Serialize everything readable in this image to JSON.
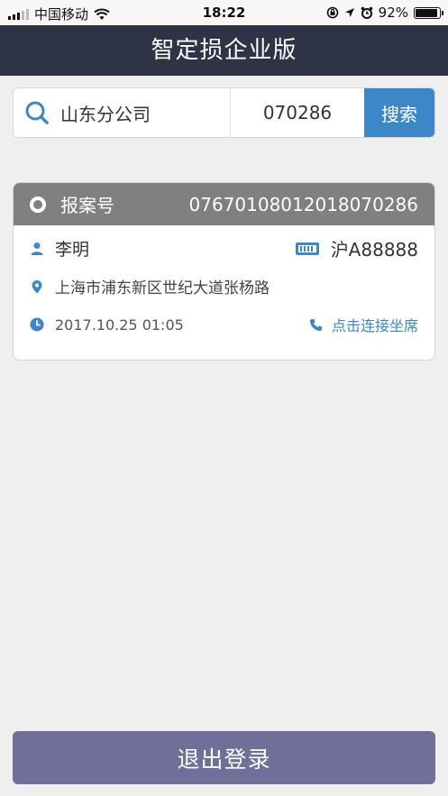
{
  "status_bar": {
    "carrier": "中国移动",
    "time": "18:22",
    "battery_percent": "92%",
    "battery_level": 0.92
  },
  "navbar": {
    "title": "智定损企业版"
  },
  "search": {
    "company": "山东分公司",
    "code": "070286",
    "button_label": "搜索"
  },
  "case_card": {
    "report_label": "报案号",
    "report_number": "07670108012018070286",
    "person_name": "李明",
    "plate": "沪A88888",
    "address": "上海市浦东新区世纪大道张杨路",
    "datetime": "2017.10.25 01:05",
    "contact_label": "点击连接坐席"
  },
  "logout_label": "退出登录",
  "colors": {
    "nav_bg": "#2e3345",
    "accent_blue": "#3d87c8",
    "card_header": "#808080",
    "logout_bg": "#6f6f9a",
    "page_bg": "#efeff0"
  },
  "icons": [
    "signal-icon",
    "wifi-icon",
    "lock-rotation-icon",
    "location-arrow-icon",
    "alarm-icon",
    "battery-icon",
    "search-icon",
    "person-icon",
    "license-plate-icon",
    "map-pin-icon",
    "clock-icon",
    "phone-icon"
  ]
}
